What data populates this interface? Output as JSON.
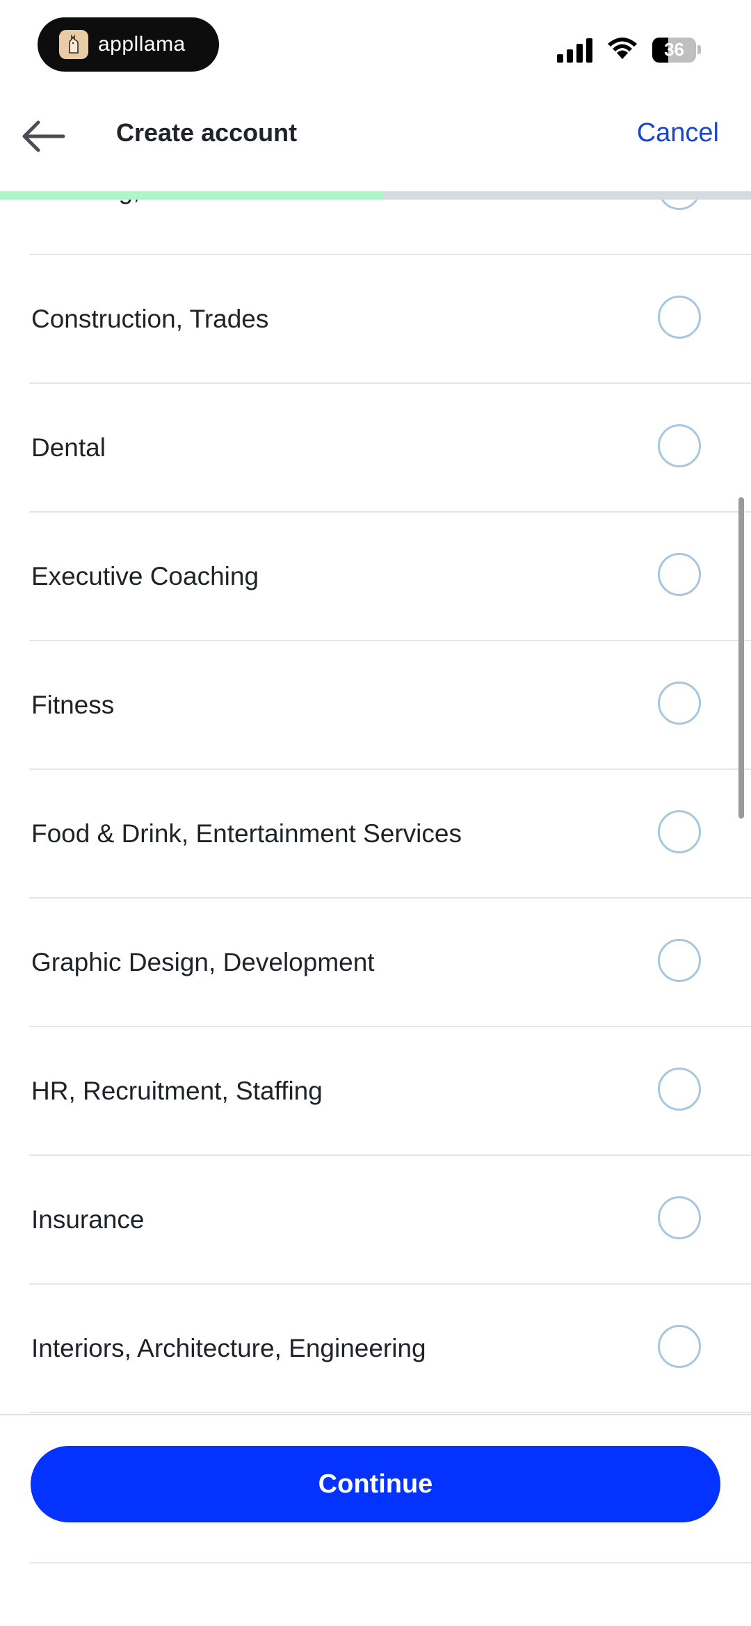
{
  "status_bar": {
    "app_name": "appllama",
    "battery_level": "36"
  },
  "header": {
    "title": "Create account",
    "cancel_label": "Cancel"
  },
  "progress": {
    "fraction": 0.51
  },
  "industries": [
    {
      "label": "Cleaning, Janitorial Services"
    },
    {
      "label": "Construction, Trades"
    },
    {
      "label": "Dental"
    },
    {
      "label": "Executive Coaching"
    },
    {
      "label": "Fitness"
    },
    {
      "label": "Food & Drink, Entertainment Services"
    },
    {
      "label": "Graphic Design, Development"
    },
    {
      "label": "HR, Recruitment, Staffing"
    },
    {
      "label": "Insurance"
    },
    {
      "label": "Interiors, Architecture, Engineering"
    }
  ],
  "footer": {
    "continue_label": "Continue"
  },
  "colors": {
    "accent": "#0433ff",
    "link": "#1a46c9",
    "progress": "#aef5c8",
    "radio_border": "#a9c6e0"
  }
}
